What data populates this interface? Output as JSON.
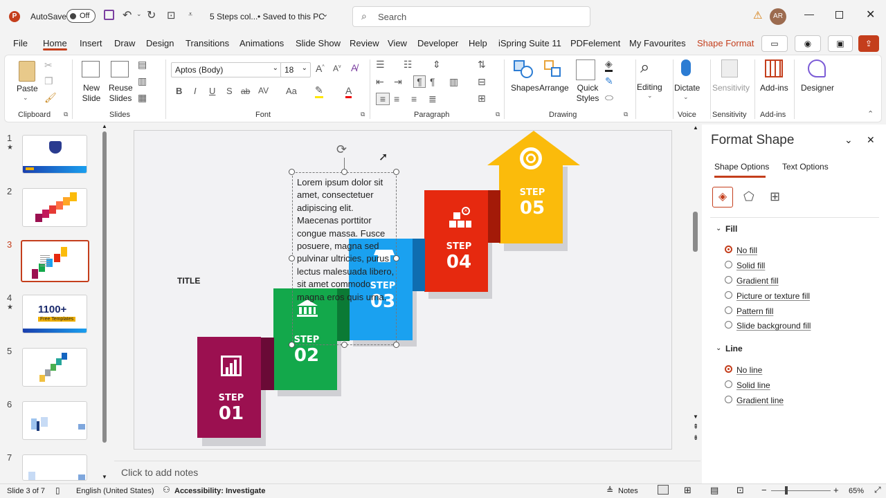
{
  "titlebar": {
    "autosave_label": "AutoSave",
    "autosave_state": "Off",
    "file_name": "5 Steps col...",
    "save_status": "• Saved to this PC",
    "search_placeholder": "Search",
    "user_initials": "AR"
  },
  "menu": {
    "tabs": [
      "File",
      "Home",
      "Insert",
      "Draw",
      "Design",
      "Transitions",
      "Animations",
      "Slide Show",
      "Review",
      "View",
      "Developer",
      "Help",
      "iSpring Suite 11",
      "PDFelement",
      "My Favourites",
      "Shape Format"
    ],
    "active_tab": "Home"
  },
  "ribbon": {
    "clipboard": {
      "paste": "Paste",
      "label": "Clipboard"
    },
    "slides": {
      "new_slide": "New Slide",
      "reuse_slides": "Reuse Slides",
      "label": "Slides"
    },
    "font": {
      "family": "Aptos (Body)",
      "size": "18",
      "label": "Font",
      "bold": "B",
      "italic": "I",
      "underline": "U",
      "shadow": "S",
      "strike": "ab",
      "spacing": "AV",
      "case": "Aa"
    },
    "paragraph": {
      "label": "Paragraph"
    },
    "drawing": {
      "shapes": "Shapes",
      "arrange": "Arrange",
      "quick_styles": "Quick Styles",
      "label": "Drawing"
    },
    "editing": {
      "label": "Editing"
    },
    "voice": {
      "dictate": "Dictate",
      "label": "Voice"
    },
    "sensitivity": {
      "button": "Sensitivity",
      "label": "Sensitivity"
    },
    "addins": {
      "button": "Add-ins",
      "label": "Add-ins"
    },
    "designer": {
      "button": "Designer"
    }
  },
  "thumbnails": {
    "numbers": [
      "1",
      "2",
      "3",
      "4",
      "5",
      "6",
      "7"
    ],
    "starred": [
      "1",
      "4"
    ],
    "selected": "3",
    "slide4_text": "1100+",
    "slide4_sub": "Free Templates"
  },
  "slide": {
    "title": "TITLE",
    "body_text": "Lorem ipsum dolor sit amet, consectetuer adipiscing elit. Maecenas porttitor congue massa. Fusce posuere, magna sed pulvinar ultricies, purus lectus malesuada libero, sit amet commodo magna eros quis urna.",
    "steps": [
      {
        "word": "STEP",
        "num": "01",
        "color": "#9b1050"
      },
      {
        "word": "STEP",
        "num": "02",
        "color": "#13a84b"
      },
      {
        "word": "STEP",
        "num": "03",
        "color": "#1aa1f0"
      },
      {
        "word": "STEP",
        "num": "04",
        "color": "#e6290f"
      },
      {
        "word": "STEP",
        "num": "05",
        "color": "#fbbb0b"
      }
    ]
  },
  "notes_placeholder": "Click to add notes",
  "format_panel": {
    "title": "Format Shape",
    "tab_shape": "Shape Options",
    "tab_text": "Text Options",
    "fill_header": "Fill",
    "fill_options": [
      "No fill",
      "Solid fill",
      "Gradient fill",
      "Picture or texture fill",
      "Pattern fill",
      "Slide background fill"
    ],
    "fill_selected": "No fill",
    "line_header": "Line",
    "line_options": [
      "No line",
      "Solid line",
      "Gradient line"
    ],
    "line_selected": "No line"
  },
  "status": {
    "slide_info": "Slide 3 of 7",
    "language": "English (United States)",
    "accessibility": "Accessibility: Investigate",
    "notes": "Notes",
    "zoom": "65%"
  },
  "colors": {
    "accent": "#c43e1c",
    "selected_tab": "#c43e1c"
  }
}
